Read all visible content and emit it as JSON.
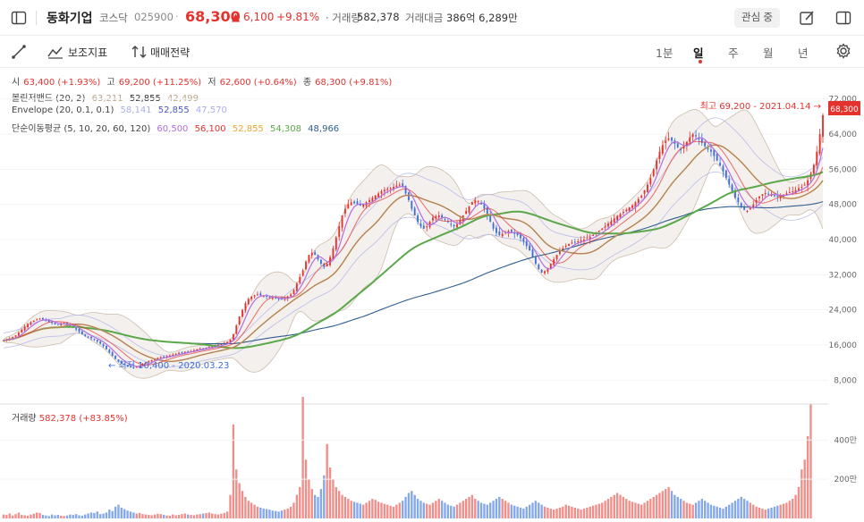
{
  "header": {
    "name": "동화기업",
    "market": "코스닥",
    "code": "025900",
    "price": "68,300",
    "change": "▲ 6,100",
    "change_pct": "+9.81%",
    "volume_label": "· 거래량",
    "volume": "582,378",
    "amount_label": "거래대금",
    "amount": "386억 6,289만",
    "favorite_label": "관심 중"
  },
  "toolbar": {
    "indicator_label": "보조지표",
    "strategy_label": "매매전략",
    "periods": [
      "1분",
      "일",
      "주",
      "월",
      "년"
    ],
    "active_period": "일"
  },
  "legend": {
    "ohlc": {
      "open_label": "시",
      "open": "63,400 (+1.93%)",
      "high_label": "고",
      "high": "69,200 (+11.25%)",
      "low_label": "저",
      "low": "62,600 (+0.64%)",
      "close_label": "종",
      "close": "68,300 (+9.81%)"
    },
    "bollinger": {
      "label": "볼린저밴드 (20, 2)",
      "values": [
        "63,211",
        "52,855",
        "42,499"
      ]
    },
    "envelope": {
      "label": "Envelope (20, 0.1, 0.1)",
      "values": [
        "58,141",
        "52,855",
        "47,570"
      ]
    },
    "ma": {
      "label": "단순이동평균 (5, 10, 20, 60, 120)",
      "values": [
        "60,500",
        "56,100",
        "52,855",
        "54,308",
        "48,966"
      ]
    },
    "volume": {
      "label": "거래량",
      "value": "582,378 (+83.85%)"
    }
  },
  "colors": {
    "up": "#e5322d",
    "down": "#3d6fd8",
    "ma5": "#b06ee0",
    "ma10": "#e5322d",
    "ma20": "#f0a830",
    "ma60": "#5aa84a",
    "ma120": "#2f5f8f",
    "bollinger": "#b9a48a",
    "envelope_upper": "#b3b6e8",
    "envelope_mid": "#4a57c8"
  },
  "annotations": {
    "high": "최고 69,200 - 2021.04.14 →",
    "low": "← 최저 10,400 - 2020.03.23"
  },
  "chart_data": {
    "type": "candlestick",
    "x_start": "2019.05",
    "x_end": "2021.04.14",
    "ylim": [
      5000,
      75000
    ],
    "yticks": [
      "72,000",
      "64,000",
      "56,000",
      "48,000",
      "40,000",
      "32,000",
      "24,000",
      "16,000",
      "8,000"
    ],
    "last_price_label": "68,300",
    "close_series": [
      17000,
      17300,
      17500,
      17800,
      18200,
      18800,
      19500,
      20200,
      20800,
      21200,
      21500,
      21800,
      22000,
      21800,
      21500,
      21200,
      21000,
      20700,
      20500,
      20800,
      21000,
      20600,
      20200,
      19900,
      19500,
      19000,
      18500,
      18000,
      17800,
      17500,
      17200,
      16800,
      16300,
      15700,
      15000,
      14300,
      13500,
      12800,
      12200,
      11800,
      11500,
      11200,
      11000,
      10900,
      11000,
      11300,
      11700,
      12000,
      12300,
      12600,
      12900,
      13100,
      13300,
      13200,
      13400,
      13600,
      13800,
      14000,
      14200,
      14300,
      14500,
      14400,
      14600,
      14800,
      15000,
      15200,
      15100,
      15300,
      15500,
      15600,
      15800,
      16000,
      16200,
      16400,
      16700,
      17200,
      18500,
      20500,
      22500,
      24000,
      25500,
      26500,
      27000,
      27300,
      27500,
      27300,
      27100,
      27000,
      26800,
      26700,
      26600,
      26500,
      26400,
      26700,
      27000,
      27500,
      28500,
      30000,
      31500,
      33000,
      35000,
      36500,
      37000,
      36500,
      35500,
      34500,
      33800,
      34500,
      36000,
      38000,
      40500,
      43000,
      45500,
      47000,
      48000,
      48500,
      48300,
      48000,
      47700,
      48000,
      48500,
      49000,
      49500,
      50000,
      50500,
      51000,
      51300,
      51500,
      51700,
      52000,
      52300,
      52500,
      52000,
      50500,
      49000,
      47000,
      45500,
      44000,
      43000,
      42500,
      43000,
      44000,
      45000,
      45300,
      45500,
      45000,
      44500,
      44000,
      43500,
      43000,
      43500,
      44500,
      45500,
      46500,
      47500,
      48500,
      49000,
      48700,
      48000,
      47000,
      45500,
      44000,
      42500,
      41500,
      41000,
      41300,
      41700,
      42000,
      41700,
      41300,
      41000,
      40300,
      39500,
      38500,
      37500,
      36000,
      34500,
      33300,
      32500,
      32800,
      33500,
      34500,
      35500,
      36500,
      37300,
      38000,
      38600,
      39000,
      39300,
      39500,
      39600,
      39800,
      40000,
      40300,
      40600,
      41000,
      41500,
      42000,
      42500,
      43000,
      43600,
      44200,
      44800,
      45400,
      45800,
      46300,
      46800,
      47300,
      47800,
      48500,
      49200,
      50000,
      51200,
      52500,
      54000,
      56000,
      58000,
      60000,
      61500,
      62500,
      63000,
      62500,
      61800,
      61000,
      60500,
      61200,
      62200,
      63300,
      64000,
      63500,
      63000,
      62000,
      61200,
      60500,
      60000,
      59000,
      58000,
      56800,
      55500,
      54000,
      52500,
      51000,
      49500,
      48500,
      47500,
      46800,
      46500,
      47200,
      48000,
      49000,
      49800,
      50300,
      50600,
      50400,
      50200,
      50000,
      49800,
      50000,
      50200,
      50500,
      50800,
      51000,
      51300,
      51700,
      52000,
      52500,
      53500,
      55000,
      57000,
      60000,
      64000,
      68300
    ],
    "volume_series": [
      20,
      18,
      25,
      15,
      22,
      30,
      18,
      16,
      14,
      20,
      24,
      30,
      28,
      18,
      15,
      12,
      20,
      16,
      18,
      14,
      12,
      15,
      20,
      18,
      22,
      16,
      14,
      20,
      25,
      30,
      28,
      35,
      22,
      25,
      30,
      45,
      38,
      60,
      70,
      55,
      48,
      40,
      35,
      30,
      25,
      28,
      22,
      20,
      18,
      16,
      20,
      24,
      22,
      18,
      15,
      14,
      20,
      16,
      18,
      22,
      25,
      20,
      18,
      16,
      20,
      22,
      25,
      28,
      30,
      25,
      22,
      20,
      24,
      28,
      35,
      120,
      480,
      250,
      180,
      140,
      110,
      90,
      80,
      70,
      60,
      55,
      50,
      48,
      45,
      40,
      38,
      35,
      40,
      45,
      50,
      60,
      80,
      120,
      160,
      620,
      300,
      200,
      150,
      120,
      110,
      150,
      220,
      380,
      260,
      200,
      160,
      140,
      120,
      110,
      100,
      90,
      85,
      80,
      75,
      70,
      80,
      90,
      100,
      95,
      85,
      80,
      75,
      70,
      65,
      60,
      70,
      80,
      90,
      110,
      130,
      140,
      120,
      100,
      90,
      80,
      75,
      70,
      80,
      90,
      100,
      90,
      80,
      70,
      65,
      60,
      70,
      80,
      90,
      100,
      110,
      120,
      100,
      90,
      80,
      75,
      70,
      80,
      90,
      100,
      110,
      100,
      90,
      80,
      70,
      65,
      60,
      55,
      50,
      60,
      70,
      80,
      90,
      80,
      70,
      60,
      55,
      50,
      45,
      50,
      55,
      60,
      70,
      65,
      60,
      55,
      50,
      45,
      50,
      55,
      60,
      65,
      70,
      75,
      80,
      90,
      100,
      110,
      120,
      130,
      120,
      110,
      100,
      90,
      85,
      80,
      75,
      70,
      80,
      90,
      100,
      110,
      120,
      130,
      140,
      150,
      160,
      140,
      120,
      110,
      100,
      90,
      80,
      75,
      70,
      80,
      90,
      100,
      90,
      80,
      70,
      65,
      60,
      55,
      50,
      60,
      70,
      80,
      90,
      100,
      110,
      100,
      90,
      80,
      70,
      60,
      55,
      50,
      45,
      50,
      55,
      60,
      65,
      70,
      75,
      80,
      90,
      100,
      120,
      160,
      250,
      300,
      420,
      582
    ],
    "volume_yticks": [
      "400만",
      "200만"
    ],
    "volume_ylim": [
      0,
      520
    ]
  }
}
